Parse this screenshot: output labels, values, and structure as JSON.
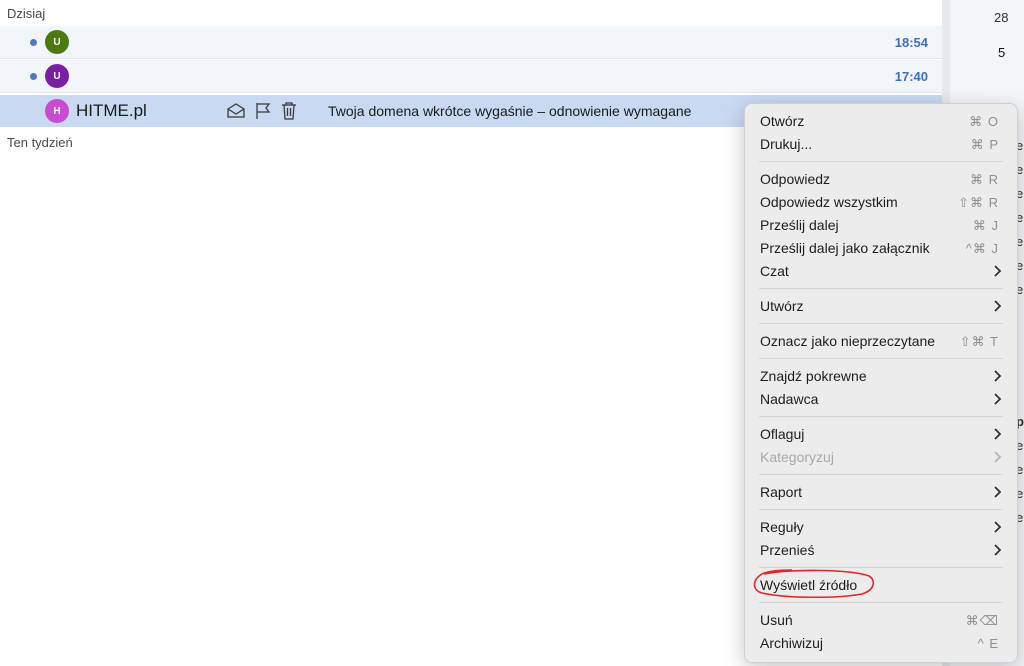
{
  "list": {
    "group_today": "Dzisiaj",
    "group_week": "Ten tydzień",
    "rows": [
      {
        "avatar": "U",
        "avatar_color": "#4c7a10",
        "time": "18:54"
      },
      {
        "avatar": "U",
        "avatar_color": "#7b1fa2",
        "time": "17:40"
      },
      {
        "avatar": "H",
        "avatar_color": "#c94bd1",
        "sender": "HITME.pl",
        "subject": "Twoja domena wkrótce wygaśnie – odnowienie wymagane"
      }
    ],
    "row_action_icons": [
      "envelope-open-icon",
      "flag-icon",
      "trash-icon"
    ]
  },
  "right_panel": {
    "numbers": [
      "28",
      "5"
    ],
    "edge_chars": [
      "e",
      "e",
      "e",
      "e",
      "e",
      "e",
      "e",
      "p",
      "e",
      "e",
      "e",
      "e"
    ]
  },
  "context_menu": {
    "items": [
      {
        "label": "Otwórz",
        "shortcut": "⌘ O"
      },
      {
        "label": "Drukuj...",
        "shortcut": "⌘ P"
      },
      {
        "label": "Odpowiedz",
        "shortcut": "⌘ R"
      },
      {
        "label": "Odpowiedz wszystkim",
        "shortcut": "⇧⌘ R"
      },
      {
        "label": "Prześlij dalej",
        "shortcut": "⌘ J"
      },
      {
        "label": "Prześlij dalej jako załącznik",
        "shortcut": "^⌘ J"
      },
      {
        "label": "Czat",
        "submenu": true
      },
      {
        "label": "Utwórz",
        "submenu": true
      },
      {
        "label": "Oznacz jako nieprzeczytane",
        "shortcut": "⇧⌘ T"
      },
      {
        "label": "Znajdź pokrewne",
        "submenu": true
      },
      {
        "label": "Nadawca",
        "submenu": true
      },
      {
        "label": "Oflaguj",
        "submenu": true
      },
      {
        "label": "Kategoryzuj",
        "submenu": true,
        "disabled": true
      },
      {
        "label": "Raport",
        "submenu": true
      },
      {
        "label": "Reguły",
        "submenu": true
      },
      {
        "label": "Przenieś",
        "submenu": true
      },
      {
        "label": "Wyświetl źródło",
        "highlighted": true
      },
      {
        "label": "Usuń",
        "shortcut": "⌘⌫"
      },
      {
        "label": "Archiwizuj",
        "shortcut": "^ E"
      }
    ],
    "highlight_color": "#e0262a"
  }
}
